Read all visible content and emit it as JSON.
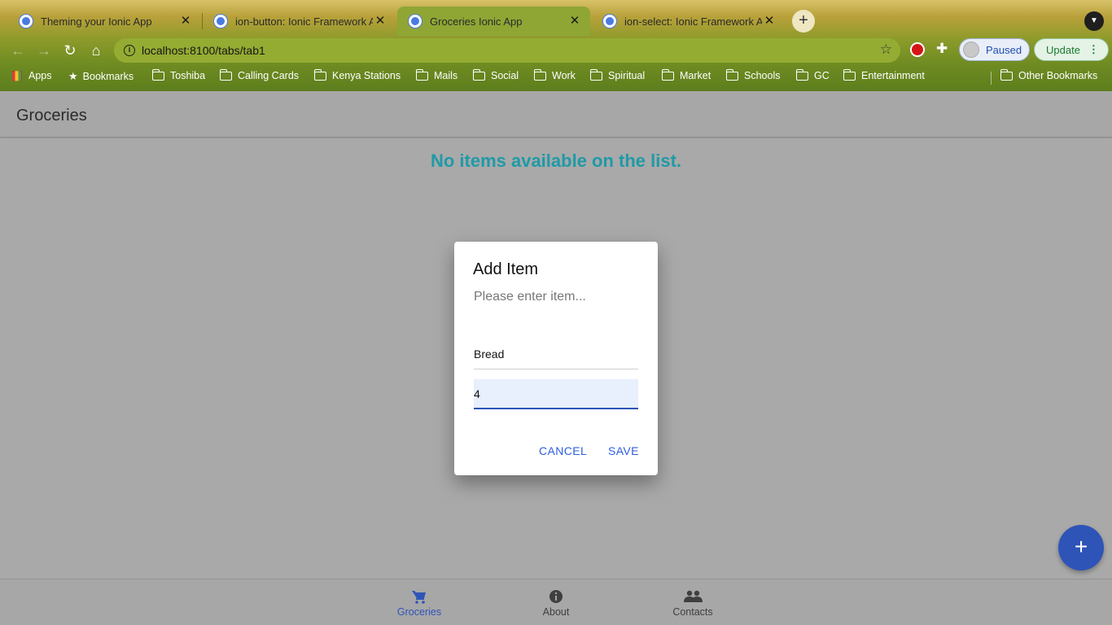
{
  "browser": {
    "tabs": [
      {
        "title": "Theming your Ionic App"
      },
      {
        "title": "ion-button: Ionic Framework API"
      },
      {
        "title": "Groceries Ionic App"
      },
      {
        "title": "ion-select: Ionic Framework API"
      }
    ],
    "url": "localhost:8100/tabs/tab1",
    "profile_label": "Paused",
    "update_label": "Update",
    "bookmarks": [
      "Apps",
      "Bookmarks",
      "Toshiba",
      "Calling Cards",
      "Kenya Stations",
      "Mails",
      "Social",
      "Work",
      "Spiritual",
      "Market",
      "Schools",
      "GC",
      "Entertainment"
    ],
    "other_bookmarks": "Other Bookmarks"
  },
  "app": {
    "title": "Groceries",
    "empty_message": "No items available on the list.",
    "fab_icon": "+"
  },
  "alert": {
    "header": "Add Item",
    "message": "Please enter item...",
    "inputs": [
      {
        "value": "Bread"
      },
      {
        "value": "4"
      }
    ],
    "cancel_label": "CANCEL",
    "save_label": "SAVE"
  },
  "tabbar": {
    "items": [
      {
        "label": "Groceries",
        "icon": "cart-icon",
        "active": true
      },
      {
        "label": "About",
        "icon": "info-icon",
        "active": false
      },
      {
        "label": "Contacts",
        "icon": "people-icon",
        "active": false
      }
    ]
  },
  "colors": {
    "primary": "#2e54b8",
    "empty_message": "#1f9aa7",
    "backdrop": "#a9a9a9"
  }
}
